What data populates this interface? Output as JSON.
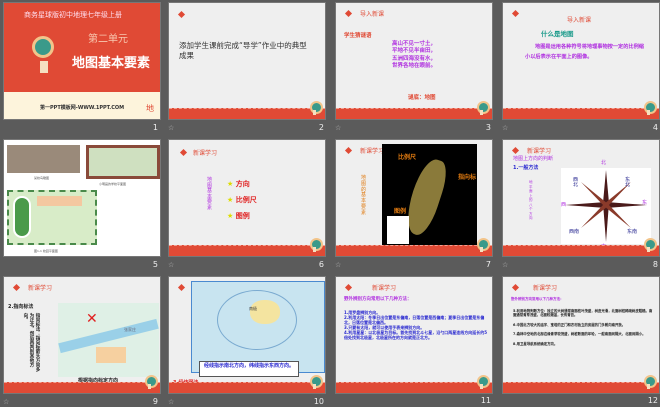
{
  "slides": [
    {
      "n": "1",
      "top": "商务星球版初中地理七年级上册",
      "unit": "第二单元",
      "title": "地图基本要素",
      "footer": "第一PPT模板网-WWW.1PPT.COM",
      "mark": "地"
    },
    {
      "n": "2",
      "body": "添加学生课前完成“导学”作业中的典型成果"
    },
    {
      "n": "3",
      "head": "导入新课",
      "sub": "学生猜谜语",
      "lines": [
        "高山不见一寸土，",
        "平地不见半亩田，",
        "五洲四海没有水，",
        "世界各地在眼前。"
      ],
      "answer": "谜底：地图"
    },
    {
      "n": "4",
      "head": "导入新课",
      "q": "什么是地图",
      "a": "地图是运用各种符号将地理事物按一定的比例缩小以后表示在平面上的图像。"
    },
    {
      "n": "5",
      "cap1": "某校鸟瞰图",
      "cap2": "小明画的学校平面图",
      "cap3": "图1-1 校园平面图"
    },
    {
      "n": "6",
      "head": "新课学习",
      "side": "地图基本要素",
      "items": [
        "方向",
        "比例尺",
        "图例"
      ]
    },
    {
      "n": "7",
      "head": "新课学习",
      "side": "地图的基本要素",
      "scale": "比例尺",
      "north": "指向标",
      "legend": "图例"
    },
    {
      "n": "8",
      "head": "新课学习",
      "b1": "地图上方向的判断",
      "b2": "1.一般方法",
      "side": "地平面上的八个方向",
      "dirs": [
        "北",
        "东北",
        "东",
        "东南",
        "南",
        "西南",
        "西",
        "西北"
      ]
    },
    {
      "n": "9",
      "head": "新课学习",
      "b1": "2.指向标法",
      "side": "指向标法：指向标箭头方向多为正北，然后再判别其他方向。",
      "village": "张家庄",
      "caption": "根据指向标定方向"
    },
    {
      "n": "10",
      "callout": "经线指示南北方向，纬线指示东西方向。",
      "label": "3.经纬网法",
      "pole": "南极"
    },
    {
      "n": "11",
      "head": "新课学习",
      "lead": "野外辨别方向常用以下几种方法：",
      "lines": [
        "1.用罗盘辨别方向。",
        "2.利用太阳：冬季日出位置是东偏南，日落位置是西偏南；夏季日出位置是东偏北，日落位置是北偏西。",
        "3.只要有太阳，就可以使用手表来辨别方向。",
        "4.利用星星：以北极星为目标。首先找到北斗七星，沿勺口两星连线方向延长约5倍处找到北极星，北极星所在的方向就是正北方。"
      ]
    },
    {
      "n": "12",
      "head": "新课学习",
      "lead": "野外辨别方向常用以下几种方法：",
      "lines": [
        "5.利用地物判断方位：独立的大树通常南面枝叶茂盛，树皮光滑，北面树枝稀疏树皮粗糙。南面通常青草茂盛，北面较潮湿，长有青苔。",
        "6.中国北方较大的庙宇、宝塔的正门和农村独立的房屋的门多朝向南开放。",
        "7.森林中空地的北部边缘青草较茂盛，树桩断面的年轮，一般南面间隔大，北面间隔小。",
        "8.用卫星导航系统确定方向。"
      ]
    }
  ],
  "colors": {
    "accent": "#e04a35",
    "purple": "#b030e0",
    "blue": "#2a2ad0"
  }
}
